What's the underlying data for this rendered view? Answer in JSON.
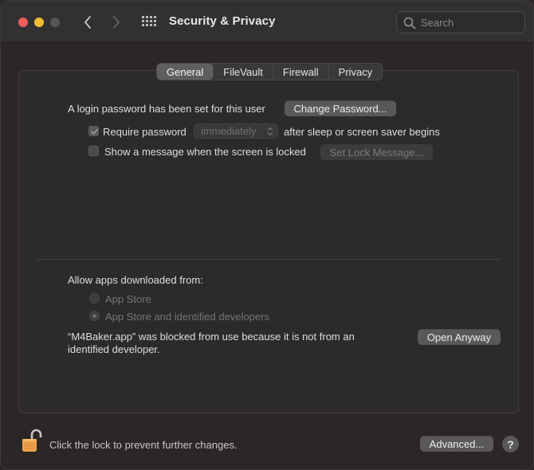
{
  "window": {
    "title": "Security & Privacy"
  },
  "search": {
    "placeholder": "Search"
  },
  "tabs": [
    {
      "label": "General",
      "active": true
    },
    {
      "label": "FileVault",
      "active": false
    },
    {
      "label": "Firewall",
      "active": false
    },
    {
      "label": "Privacy",
      "active": false
    }
  ],
  "general": {
    "login_text": "A login password has been set for this user",
    "change_password_label": "Change Password...",
    "require_password_label": "Require password",
    "require_password_checked": true,
    "require_password_delay": "immediately",
    "after_sleep_text": "after sleep or screen saver begins",
    "show_message_label": "Show a message when the screen is locked",
    "show_message_checked": false,
    "set_lock_message_label": "Set Lock Message..."
  },
  "allow_apps": {
    "heading": "Allow apps downloaded from:",
    "options": [
      {
        "label": "App Store",
        "selected": false
      },
      {
        "label": "App Store and identified developers",
        "selected": true
      }
    ],
    "blocked_line1": "“M4Baker.app” was blocked from use because it is not from an",
    "blocked_line2": "identified developer.",
    "open_anyway_label": "Open Anyway"
  },
  "footer": {
    "lock_text": "Click the lock to prevent further changes.",
    "advanced_label": "Advanced...",
    "help_label": "?"
  },
  "colors": {
    "lock_accent": "#f0a24a",
    "traffic_red": "#ee5d58",
    "traffic_yellow": "#f4be34"
  }
}
